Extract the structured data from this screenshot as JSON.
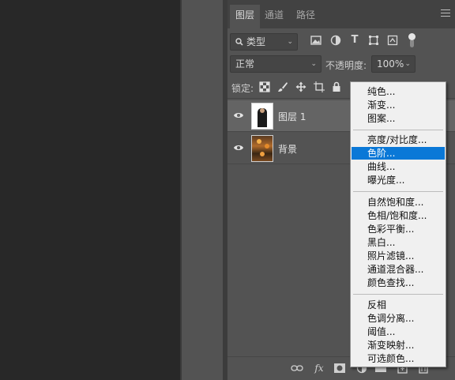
{
  "panel": {
    "tabs": [
      "图层",
      "通道",
      "路径"
    ],
    "filter": {
      "label": "类型"
    },
    "blend": {
      "mode": "正常",
      "opacity_label": "不透明度:",
      "opacity_value": "100%"
    },
    "lock": {
      "label": "锁定:"
    },
    "layers": [
      {
        "name": "图层 1",
        "visible": true,
        "selected": true
      },
      {
        "name": "背景",
        "visible": true,
        "selected": false
      }
    ],
    "bottom": {
      "fx_label": "fx"
    }
  },
  "adjustment_menu": {
    "groups": [
      [
        "纯色...",
        "渐变...",
        "图案..."
      ],
      [
        "亮度/对比度...",
        "色阶...",
        "曲线...",
        "曝光度..."
      ],
      [
        "自然饱和度...",
        "色相/饱和度...",
        "色彩平衡...",
        "黑白...",
        "照片滤镜...",
        "通道混合器...",
        "颜色查找..."
      ],
      [
        "反相",
        "色调分离...",
        "阈值...",
        "渐变映射...",
        "可选颜色..."
      ]
    ],
    "highlighted": "色阶..."
  },
  "colors": {
    "accent": "#0a78d7",
    "panel_bg": "#535353",
    "canvas_bg": "#282828"
  }
}
